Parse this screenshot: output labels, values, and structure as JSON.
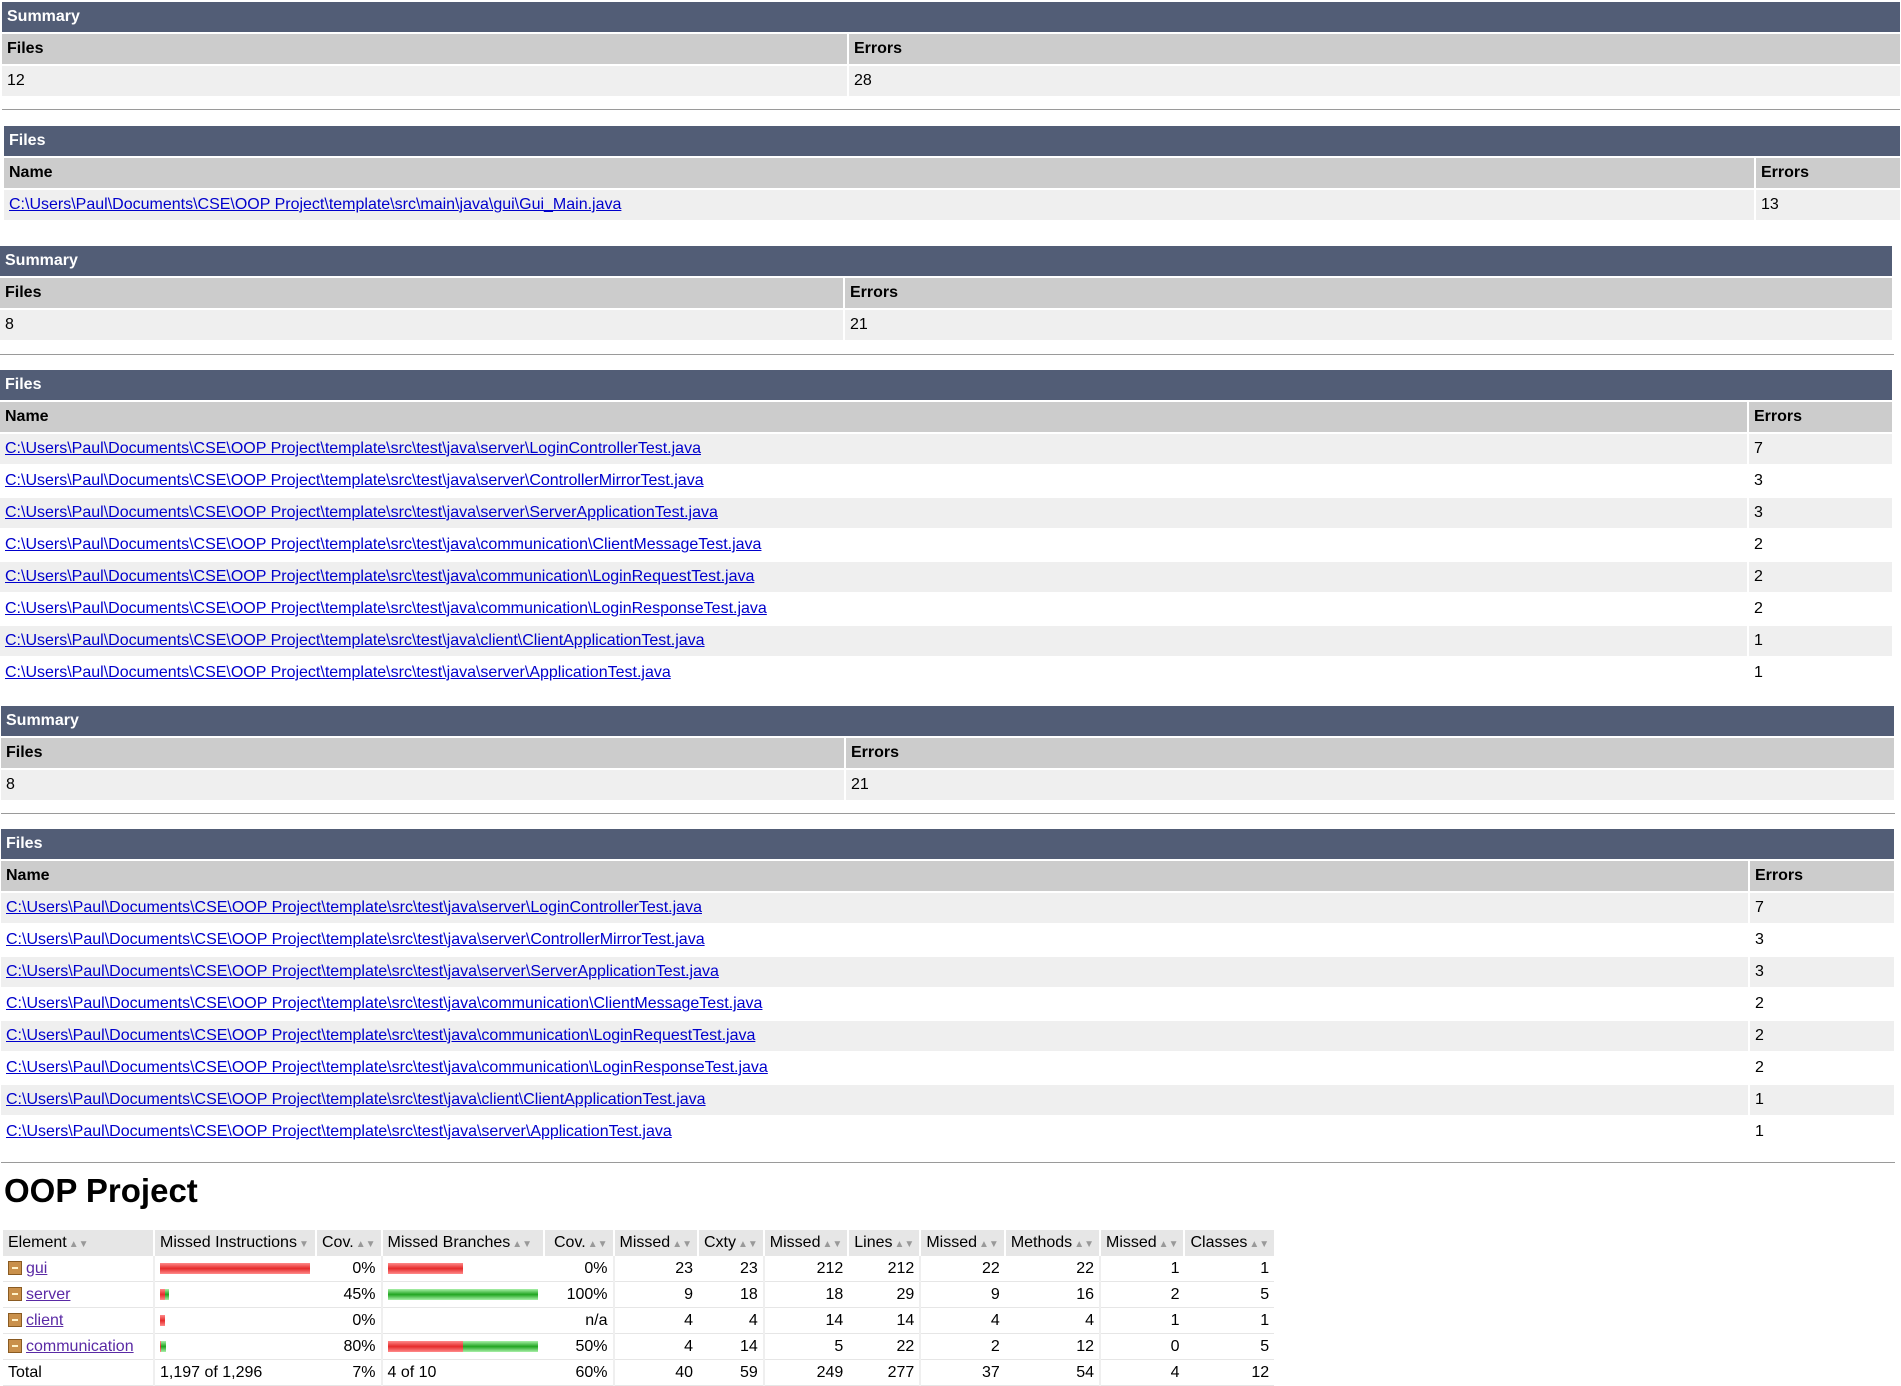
{
  "report1": {
    "summary_caption": "Summary",
    "summary_headers": {
      "files": "Files",
      "errors": "Errors"
    },
    "summary_values": {
      "files": "12",
      "errors": "28"
    },
    "files_caption": "Files",
    "files_headers": {
      "name": "Name",
      "errors": "Errors"
    },
    "files": [
      {
        "name": "C:\\Users\\Paul\\Documents\\CSE\\OOP Project\\template\\src\\main\\java\\gui\\Gui_Main.java",
        "errors": "13"
      }
    ]
  },
  "report2": {
    "summary_caption": "Summary",
    "summary_headers": {
      "files": "Files",
      "errors": "Errors"
    },
    "summary_values": {
      "files": "8",
      "errors": "21"
    },
    "files_caption": "Files",
    "files_headers": {
      "name": "Name",
      "errors": "Errors"
    },
    "files": [
      {
        "name": "C:\\Users\\Paul\\Documents\\CSE\\OOP Project\\template\\src\\test\\java\\server\\LoginControllerTest.java",
        "errors": "7"
      },
      {
        "name": "C:\\Users\\Paul\\Documents\\CSE\\OOP Project\\template\\src\\test\\java\\server\\ControllerMirrorTest.java",
        "errors": "3"
      },
      {
        "name": "C:\\Users\\Paul\\Documents\\CSE\\OOP Project\\template\\src\\test\\java\\server\\ServerApplicationTest.java",
        "errors": "3"
      },
      {
        "name": "C:\\Users\\Paul\\Documents\\CSE\\OOP Project\\template\\src\\test\\java\\communication\\ClientMessageTest.java",
        "errors": "2"
      },
      {
        "name": "C:\\Users\\Paul\\Documents\\CSE\\OOP Project\\template\\src\\test\\java\\communication\\LoginRequestTest.java",
        "errors": "2"
      },
      {
        "name": "C:\\Users\\Paul\\Documents\\CSE\\OOP Project\\template\\src\\test\\java\\communication\\LoginResponseTest.java",
        "errors": "2"
      },
      {
        "name": "C:\\Users\\Paul\\Documents\\CSE\\OOP Project\\template\\src\\test\\java\\client\\ClientApplicationTest.java",
        "errors": "1"
      },
      {
        "name": "C:\\Users\\Paul\\Documents\\CSE\\OOP Project\\template\\src\\test\\java\\server\\ApplicationTest.java",
        "errors": "1"
      }
    ]
  },
  "report3": {
    "summary_caption": "Summary",
    "summary_headers": {
      "files": "Files",
      "errors": "Errors"
    },
    "summary_values": {
      "files": "8",
      "errors": "21"
    },
    "files_caption": "Files",
    "files_headers": {
      "name": "Name",
      "errors": "Errors"
    },
    "files": [
      {
        "name": "C:\\Users\\Paul\\Documents\\CSE\\OOP Project\\template\\src\\test\\java\\server\\LoginControllerTest.java",
        "errors": "7"
      },
      {
        "name": "C:\\Users\\Paul\\Documents\\CSE\\OOP Project\\template\\src\\test\\java\\server\\ControllerMirrorTest.java",
        "errors": "3"
      },
      {
        "name": "C:\\Users\\Paul\\Documents\\CSE\\OOP Project\\template\\src\\test\\java\\server\\ServerApplicationTest.java",
        "errors": "3"
      },
      {
        "name": "C:\\Users\\Paul\\Documents\\CSE\\OOP Project\\template\\src\\test\\java\\communication\\ClientMessageTest.java",
        "errors": "2"
      },
      {
        "name": "C:\\Users\\Paul\\Documents\\CSE\\OOP Project\\template\\src\\test\\java\\communication\\LoginRequestTest.java",
        "errors": "2"
      },
      {
        "name": "C:\\Users\\Paul\\Documents\\CSE\\OOP Project\\template\\src\\test\\java\\communication\\LoginResponseTest.java",
        "errors": "2"
      },
      {
        "name": "C:\\Users\\Paul\\Documents\\CSE\\OOP Project\\template\\src\\test\\java\\client\\ClientApplicationTest.java",
        "errors": "1"
      },
      {
        "name": "C:\\Users\\Paul\\Documents\\CSE\\OOP Project\\template\\src\\test\\java\\server\\ApplicationTest.java",
        "errors": "1"
      }
    ]
  },
  "coverage": {
    "title": "OOP Project",
    "headers": [
      "Element",
      "Missed Instructions",
      "Cov.",
      "Missed Branches",
      "Cov.",
      "Missed",
      "Cxty",
      "Missed",
      "Lines",
      "Missed",
      "Methods",
      "Missed",
      "Classes"
    ],
    "rows": [
      {
        "name": "gui",
        "instr_cov": "0%",
        "instr_missed_frac": 1.0,
        "branch_cov": "0%",
        "branch_missed_frac": 1.0,
        "branch_total_frac": 0.5,
        "missed_cxty": "23",
        "cxty": "23",
        "missed_lines": "212",
        "lines": "212",
        "missed_methods": "22",
        "methods": "22",
        "missed_classes": "1",
        "classes": "1"
      },
      {
        "name": "server",
        "instr_cov": "45%",
        "instr_missed_frac": 0.55,
        "instr_total_frac": 0.06,
        "branch_cov": "100%",
        "branch_missed_frac": 0.0,
        "branch_total_frac": 1.0,
        "missed_cxty": "9",
        "cxty": "18",
        "missed_lines": "18",
        "lines": "29",
        "missed_methods": "9",
        "methods": "16",
        "missed_classes": "2",
        "classes": "5"
      },
      {
        "name": "client",
        "instr_cov": "0%",
        "instr_missed_frac": 1.0,
        "instr_total_frac": 0.03,
        "branch_cov": "n/a",
        "missed_cxty": "4",
        "cxty": "4",
        "missed_lines": "14",
        "lines": "14",
        "missed_methods": "4",
        "methods": "4",
        "missed_classes": "1",
        "classes": "1"
      },
      {
        "name": "communication",
        "instr_cov": "80%",
        "instr_missed_frac": 0.2,
        "instr_total_frac": 0.04,
        "branch_cov": "50%",
        "branch_missed_frac": 0.5,
        "branch_total_frac": 1.0,
        "missed_cxty": "4",
        "cxty": "14",
        "missed_lines": "5",
        "lines": "22",
        "missed_methods": "2",
        "methods": "12",
        "missed_classes": "0",
        "classes": "5"
      }
    ],
    "total": {
      "label": "Total",
      "instructions": "1,197 of 1,296",
      "instr_cov": "7%",
      "branches": "4 of 10",
      "branch_cov": "60%",
      "missed_cxty": "40",
      "cxty": "59",
      "missed_lines": "249",
      "lines": "277",
      "missed_methods": "37",
      "methods": "54",
      "missed_classes": "4",
      "classes": "12"
    }
  }
}
